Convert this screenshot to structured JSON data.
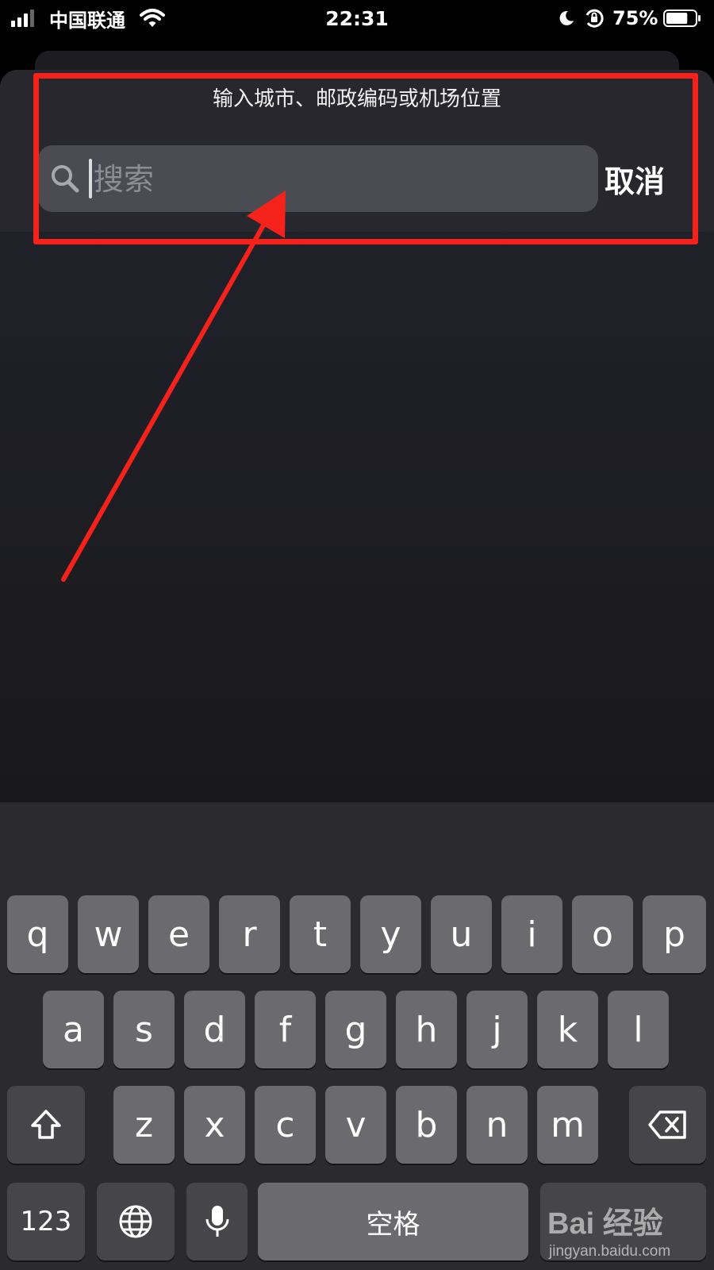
{
  "status_bar": {
    "carrier": "中国联通",
    "time": "22:31",
    "battery_percent": "75%",
    "battery_level": 0.75,
    "signal_bars": 3,
    "icons": [
      "signal-icon",
      "wifi-icon",
      "moon-icon",
      "orientation-lock-icon",
      "battery-icon"
    ]
  },
  "search": {
    "prompt": "输入城市、邮政编码或机场位置",
    "placeholder": "搜索",
    "cancel_label": "取消"
  },
  "keyboard": {
    "row1": [
      "q",
      "w",
      "e",
      "r",
      "t",
      "y",
      "u",
      "i",
      "o",
      "p"
    ],
    "row2": [
      "a",
      "s",
      "d",
      "f",
      "g",
      "h",
      "j",
      "k",
      "l"
    ],
    "row3": [
      "z",
      "x",
      "c",
      "v",
      "b",
      "n",
      "m"
    ],
    "numbers_label": "123",
    "space_label": "空格",
    "icons": [
      "shift-icon",
      "delete-icon",
      "globe-icon",
      "microphone-icon"
    ]
  },
  "watermark": {
    "logo": "Bai 经验",
    "url": "jingyan.baidu.com"
  },
  "colors": {
    "annotation": "#f5221c",
    "key": "#6b6b6d",
    "key_dark": "#464648",
    "keyboard_bg": "#2b2b2d"
  }
}
